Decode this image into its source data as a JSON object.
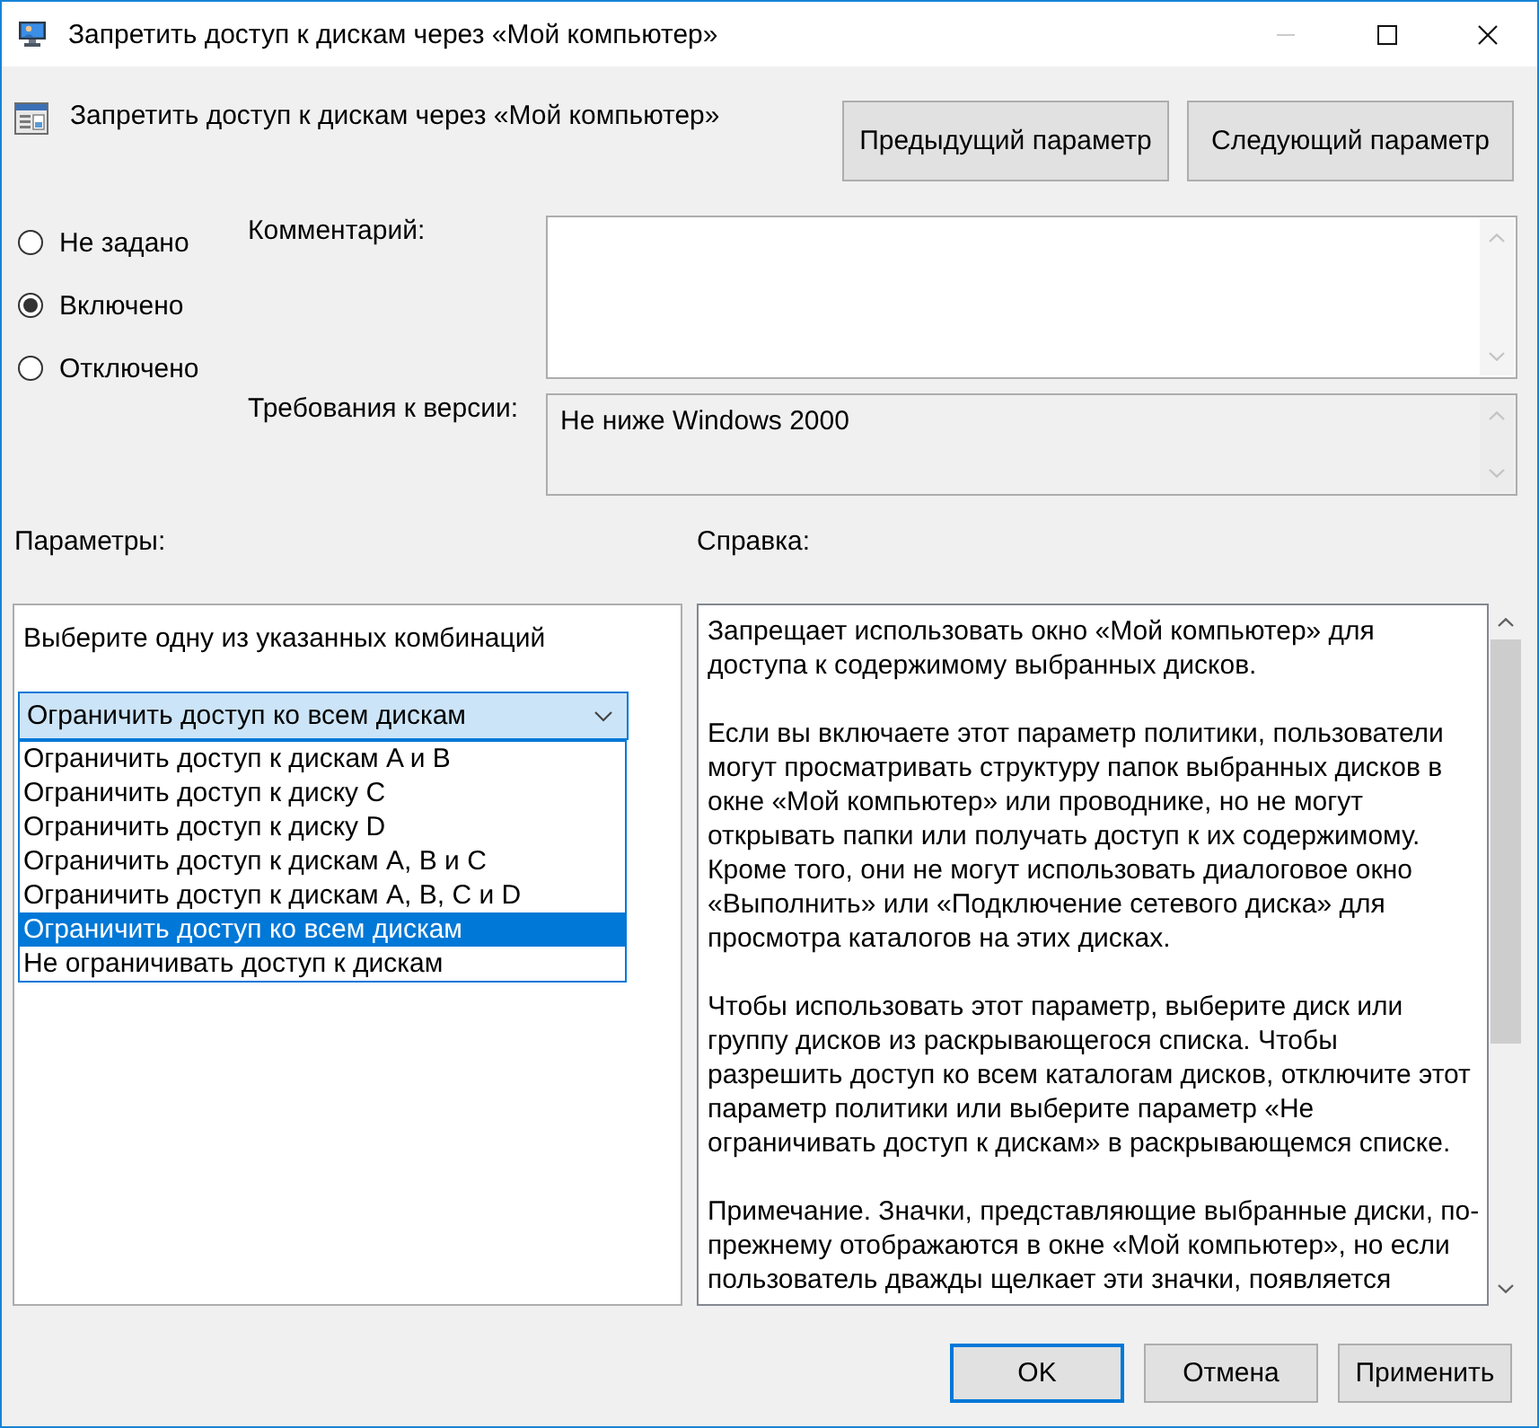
{
  "window": {
    "title": "Запретить доступ к дискам через «Мой компьютер»",
    "controls": [
      {
        "kind": "minimize",
        "disabled": true
      },
      {
        "kind": "maximize",
        "disabled": false
      },
      {
        "kind": "close",
        "disabled": false
      }
    ]
  },
  "header": {
    "setting_name": "Запретить доступ к дискам через «Мой компьютер»",
    "buttons": [
      {
        "label": "Предыдущий параметр"
      },
      {
        "label": "Следующий параметр"
      }
    ]
  },
  "state_options": [
    {
      "label": "Не задано",
      "selected": false
    },
    {
      "label": "Включено",
      "selected": true
    },
    {
      "label": "Отключено",
      "selected": false
    }
  ],
  "comment": {
    "label": "Комментарий:"
  },
  "version": {
    "label": "Требования к версии:",
    "value": "Не ниже Windows 2000"
  },
  "options_panel": {
    "heading": "Параметры:",
    "prompt": "Выберите одну из указанных комбинаций",
    "combo_value": "Ограничить доступ ко всем дискам",
    "expanded": true,
    "items": [
      {
        "label": "Ограничить доступ к дискам A и B",
        "selected": false
      },
      {
        "label": "Ограничить доступ к диску C",
        "selected": false
      },
      {
        "label": "Ограничить доступ к диску D",
        "selected": false
      },
      {
        "label": "Ограничить доступ к дискам A, B и C",
        "selected": false
      },
      {
        "label": "Ограничить доступ к дискам A, B, C и D",
        "selected": false
      },
      {
        "label": "Ограничить доступ ко всем дискам",
        "selected": true
      },
      {
        "label": "Не ограничивать доступ к дискам",
        "selected": false
      }
    ]
  },
  "help_panel": {
    "heading": "Справка:",
    "paragraphs": [
      "Запрещает использовать окно «Мой компьютер» для доступа к содержимому выбранных дисков.",
      "Если вы включаете этот параметр политики, пользователи могут просматривать структуру папок выбранных дисков в окне «Мой компьютер» или проводнике, но не могут открывать папки или получать доступ к их содержимому. Кроме того, они не могут использовать диалоговое окно «Выполнить» или «Подключение сетевого диска» для просмотра каталогов на этих дисках.",
      "Чтобы использовать этот параметр, выберите диск или группу дисков из раскрывающегося списка. Чтобы разрешить доступ ко всем каталогам дисков, отключите этот параметр политики или выберите параметр «Не ограничивать доступ к дискам» в раскрывающемся списке.",
      "Примечание. Значки, представляющие выбранные диски, по-прежнему отображаются в окне «Мой компьютер», но если пользователь дважды щелкает эти значки, появляется"
    ]
  },
  "footer_buttons": [
    {
      "label": "OK",
      "default": true
    },
    {
      "label": "Отмена",
      "default": false
    },
    {
      "label": "Применить",
      "default": false
    }
  ]
}
